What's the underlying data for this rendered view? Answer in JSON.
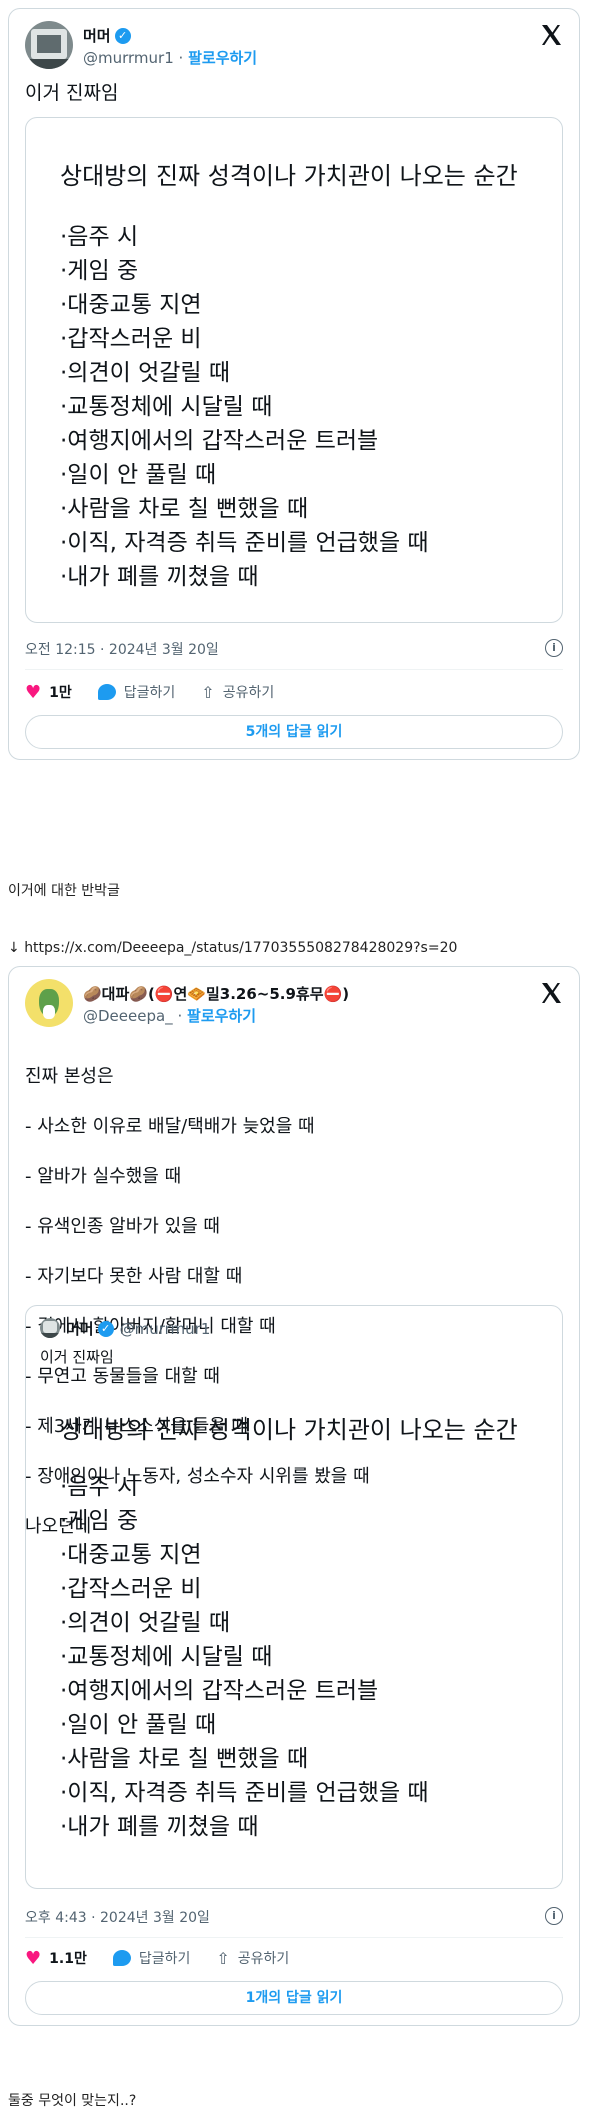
{
  "tweet1": {
    "name": "머머",
    "handle": "@murrmur1",
    "follow": "팔로우하기",
    "text": "이거 진짜임",
    "image_title": "상대방의 진짜 성격이나 가치관이 나오는 순간",
    "image_items": [
      "·음주 시",
      "·게임 중",
      "·대중교통 지연",
      "·갑작스러운 비",
      "·의견이 엇갈릴 때",
      "·교통정체에 시달릴 때",
      "·여행지에서의 갑작스러운 트러블",
      "·일이 안 풀릴 때",
      "·사람을 차로 칠 뻔했을 때",
      "·이직, 자격증 취득 준비를 언급했을 때",
      "·내가 폐를 끼쳤을 때"
    ],
    "timestamp": "오전 12:15 · 2024년 3월 20일",
    "likes": "1만",
    "reply_label": "답글하기",
    "share_label": "공유하기",
    "read_replies": "5개의 답글 읽기"
  },
  "caption1": "이거에 대한 반박글",
  "link": {
    "arrow": "↓",
    "url": "https://x.com/Deeeepa_/status/1770355508278428029?s=20"
  },
  "tweet2": {
    "name": "🥔대파🥔(⛔연🧇밀3.26~5.9휴무⛔)",
    "handle": "@Deeeepa_",
    "follow": "팔로우하기",
    "text_lines": [
      "진짜 본성은",
      "- 사소한 이유로 배달/택배가 늦었을 때",
      "- 알바가 실수했을 때",
      "- 유색인종 알바가 있을 때",
      "- 자기보다 못한 사람 대할 때",
      "- 길에서 할아버지/할머니 대할 때",
      "- 무연고 동물들을 대할 때",
      "- 제3세계 뉴스소식을 들을 때",
      "- 장애인이나 노동자, 성소수자 시위를 봤을 때",
      "나오던데"
    ],
    "quote": {
      "name": "머머",
      "handle": "@murrmur1",
      "text": "이거 진짜임",
      "image_title": "상대방의 진짜 성격이나 가치관이 나오는 순간",
      "image_items": [
        "·음주 시",
        "·게임 중",
        "·대중교통 지연",
        "·갑작스러운 비",
        "·의견이 엇갈릴 때",
        "·교통정체에 시달릴 때",
        "·여행지에서의 갑작스러운 트러블",
        "·일이 안 풀릴 때",
        "·사람을 차로 칠 뻔했을 때",
        "·이직, 자격증 취득 준비를 언급했을 때",
        "·내가 폐를 끼쳤을 때"
      ]
    },
    "timestamp": "오후 4:43 · 2024년 3월 20일",
    "likes": "1.1만",
    "reply_label": "답글하기",
    "share_label": "공유하기",
    "read_replies": "1개의 답글 읽기"
  },
  "caption2": "둘중 무엇이 맞는지..?",
  "colors": {
    "link_blue": "#1d9bf0",
    "like_pink": "#f91880",
    "border": "#cfd9de",
    "secondary_text": "#536471"
  },
  "icons": [
    "verified-badge-icon",
    "x-logo-icon",
    "heart-icon",
    "reply-bubble-icon",
    "share-icon",
    "info-icon",
    "down-arrow-icon"
  ]
}
